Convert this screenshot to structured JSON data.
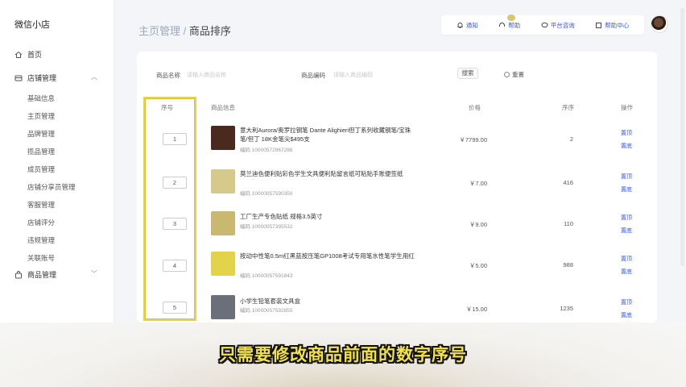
{
  "app": {
    "title": "微信小店"
  },
  "sidebar": {
    "home": "首页",
    "store_group": "店铺管理",
    "store_items": [
      "基础信息",
      "主页管理",
      "品牌管理",
      "揽品管理",
      "成员管理",
      "店铺分享员管理",
      "客服管理",
      "店铺评分",
      "违规管理",
      "关联账号"
    ],
    "goods_group": "商品管理"
  },
  "header": {
    "breadcrumb_parent": "主页管理 /",
    "breadcrumb_current": "商品排序",
    "actions": [
      "通知",
      "帮助",
      "平台咨询",
      "帮助中心"
    ]
  },
  "filters": {
    "name_label": "商品名称",
    "name_placeholder": "请输入商品名称",
    "code_label": "商品编码",
    "code_placeholder": "请输入商品编码",
    "search_label": "搜索",
    "reset_label": "重置"
  },
  "table": {
    "columns": [
      "序号",
      "商品信息",
      "价格",
      "序序",
      "操作"
    ],
    "rows": [
      {
        "seq": "1",
        "title": "意大利Aurora/奥罗拉钢笔 Dante Alighieri但丁系列收藏钢笔/宝珠笔/但丁 18K金笔尖$495支",
        "code": "编码 10000572967286",
        "price": "￥7799.00",
        "sort": "2",
        "op1": "置顶",
        "op2": "置底",
        "thumb": "#4a2a1f"
      },
      {
        "seq": "2",
        "title": "莫兰迪色便利贴彩色学生文具便利贴留言纸可粘贴手账便签纸",
        "code": "编码 10000057590350",
        "price": "￥7.00",
        "sort": "416",
        "op1": "置顶",
        "op2": "置底",
        "thumb": "#d7c98a"
      },
      {
        "seq": "3",
        "title": "工厂生产专色贴纸 规格3.5英寸",
        "code": "编码 10000057395532",
        "price": "￥9.00",
        "sort": "110",
        "op1": "置顶",
        "op2": "置底",
        "thumb": "#c9b870"
      },
      {
        "seq": "4",
        "title": "按动中性笔0.5m红黑蓝按压笔GP1008考试专用笔水性笔学生用红",
        "code": "编码 10000057591843",
        "price": "￥5.00",
        "sort": "988",
        "op1": "置顶",
        "op2": "置底",
        "thumb": "#e2d34a"
      },
      {
        "seq": "5",
        "title": "小学生铅笔套装文具盒",
        "code": "编码 10000057592855",
        "price": "￥15.00",
        "sort": "1235",
        "op1": "置顶",
        "op2": "置底",
        "thumb": "#6a6f7a"
      }
    ]
  },
  "subtitle": "只需要修改商品前面的数字序号",
  "colors": {
    "accent": "#3a5bd9",
    "highlight": "#e7d34b",
    "subtitle": "#f2e24a"
  }
}
